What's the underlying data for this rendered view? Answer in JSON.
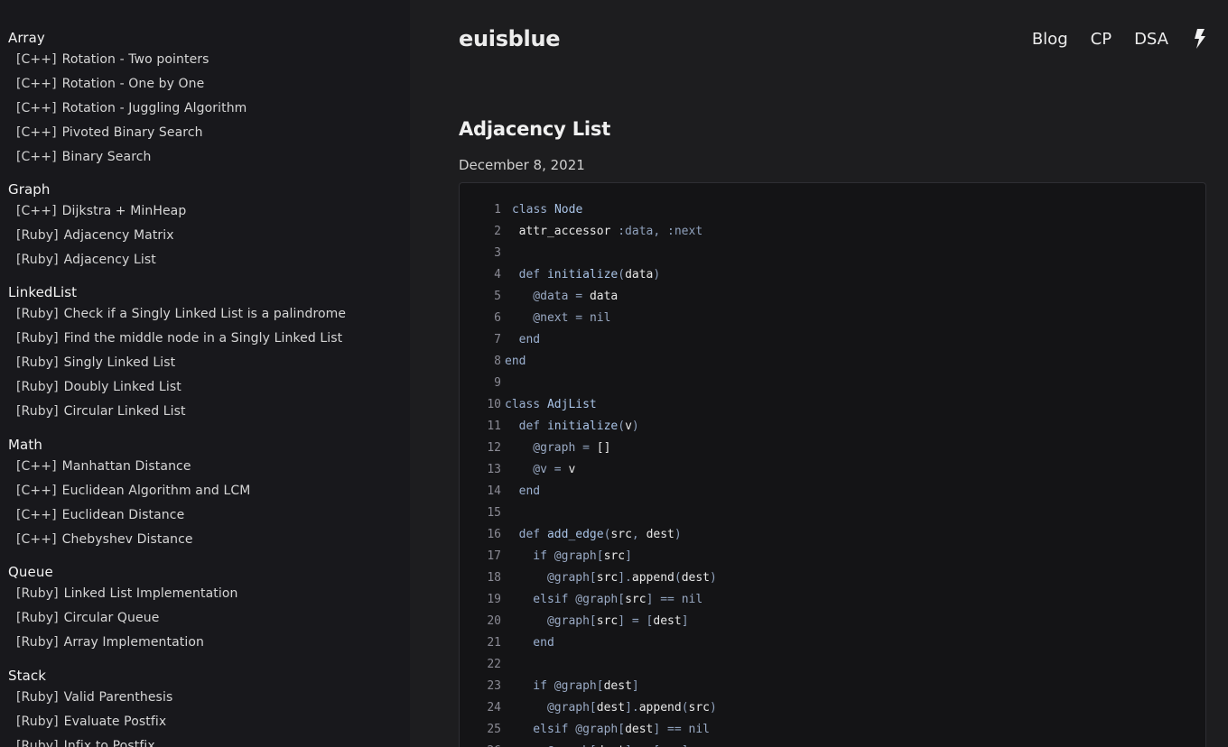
{
  "sidebar": {
    "groups": [
      {
        "title": "Array",
        "items": [
          {
            "lang": "[C++]",
            "label": "Rotation - Two pointers"
          },
          {
            "lang": "[C++]",
            "label": "Rotation - One by One"
          },
          {
            "lang": "[C++]",
            "label": "Rotation - Juggling Algorithm"
          },
          {
            "lang": "[C++]",
            "label": "Pivoted Binary Search"
          },
          {
            "lang": "[C++]",
            "label": "Binary Search"
          }
        ]
      },
      {
        "title": "Graph",
        "items": [
          {
            "lang": "[C++]",
            "label": "Dijkstra + MinHeap"
          },
          {
            "lang": "[Ruby]",
            "label": "Adjacency Matrix"
          },
          {
            "lang": "[Ruby]",
            "label": "Adjacency List"
          }
        ]
      },
      {
        "title": "LinkedList",
        "items": [
          {
            "lang": "[Ruby]",
            "label": "Check if a Singly Linked List is a palindrome"
          },
          {
            "lang": "[Ruby]",
            "label": "Find the middle node in a Singly Linked List"
          },
          {
            "lang": "[Ruby]",
            "label": "Singly Linked List"
          },
          {
            "lang": "[Ruby]",
            "label": "Doubly Linked List"
          },
          {
            "lang": "[Ruby]",
            "label": "Circular Linked List"
          }
        ]
      },
      {
        "title": "Math",
        "items": [
          {
            "lang": "[C++]",
            "label": "Manhattan Distance"
          },
          {
            "lang": "[C++]",
            "label": "Euclidean Algorithm and LCM"
          },
          {
            "lang": "[C++]",
            "label": "Euclidean Distance"
          },
          {
            "lang": "[C++]",
            "label": "Chebyshev Distance"
          }
        ]
      },
      {
        "title": "Queue",
        "items": [
          {
            "lang": "[Ruby]",
            "label": "Linked List Implementation"
          },
          {
            "lang": "[Ruby]",
            "label": "Circular Queue"
          },
          {
            "lang": "[Ruby]",
            "label": "Array Implementation"
          }
        ]
      },
      {
        "title": "Stack",
        "items": [
          {
            "lang": "[Ruby]",
            "label": "Valid Parenthesis"
          },
          {
            "lang": "[Ruby]",
            "label": "Evaluate Postfix"
          },
          {
            "lang": "[Ruby]",
            "label": "Infix to Postfix"
          }
        ]
      }
    ]
  },
  "header": {
    "brand": "euisblue",
    "nav": [
      "Blog",
      "CP",
      "DSA"
    ],
    "theme_icon": "bolt-icon"
  },
  "post": {
    "title": "Adjacency List",
    "date": "December 8, 2021"
  },
  "code": [
    [
      [
        "k",
        "class "
      ],
      [
        "c",
        "Node"
      ]
    ],
    [
      [
        "i",
        "  attr_accessor "
      ],
      [
        "s",
        ":data, :next"
      ]
    ],
    [],
    [
      [
        "k",
        "  def "
      ],
      [
        "c",
        "initialize"
      ],
      [
        "s",
        "("
      ],
      [
        "i",
        "data"
      ],
      [
        "s",
        ")"
      ]
    ],
    [
      [
        "v",
        "    @data"
      ],
      [
        "s",
        " = "
      ],
      [
        "i",
        "data"
      ]
    ],
    [
      [
        "v",
        "    @next"
      ],
      [
        "s",
        " = "
      ],
      [
        "n",
        "nil"
      ]
    ],
    [
      [
        "k",
        "  end"
      ]
    ],
    [
      [
        "k",
        "end"
      ]
    ],
    [],
    [
      [
        "k",
        "class "
      ],
      [
        "c",
        "AdjList"
      ]
    ],
    [
      [
        "k",
        "  def "
      ],
      [
        "c",
        "initialize"
      ],
      [
        "s",
        "("
      ],
      [
        "i",
        "v"
      ],
      [
        "s",
        ")"
      ]
    ],
    [
      [
        "v",
        "    @graph"
      ],
      [
        "s",
        " = "
      ],
      [
        "i",
        "[]"
      ]
    ],
    [
      [
        "v",
        "    @v"
      ],
      [
        "s",
        " = "
      ],
      [
        "i",
        "v"
      ]
    ],
    [
      [
        "k",
        "  end"
      ]
    ],
    [],
    [
      [
        "k",
        "  def "
      ],
      [
        "c",
        "add_edge"
      ],
      [
        "s",
        "("
      ],
      [
        "i",
        "src"
      ],
      [
        "s",
        ", "
      ],
      [
        "i",
        "dest"
      ],
      [
        "s",
        ")"
      ]
    ],
    [
      [
        "k",
        "    if "
      ],
      [
        "v",
        "@graph"
      ],
      [
        "s",
        "["
      ],
      [
        "i",
        "src"
      ],
      [
        "s",
        "]"
      ]
    ],
    [
      [
        "v",
        "      @graph"
      ],
      [
        "s",
        "["
      ],
      [
        "i",
        "src"
      ],
      [
        "s",
        "]."
      ],
      [
        "i",
        "append"
      ],
      [
        "s",
        "("
      ],
      [
        "i",
        "dest"
      ],
      [
        "s",
        ")"
      ]
    ],
    [
      [
        "k",
        "    elsif "
      ],
      [
        "v",
        "@graph"
      ],
      [
        "s",
        "["
      ],
      [
        "i",
        "src"
      ],
      [
        "s",
        "] == "
      ],
      [
        "n",
        "nil"
      ]
    ],
    [
      [
        "v",
        "      @graph"
      ],
      [
        "s",
        "["
      ],
      [
        "i",
        "src"
      ],
      [
        "s",
        "] = ["
      ],
      [
        "i",
        "dest"
      ],
      [
        "s",
        "]"
      ]
    ],
    [
      [
        "k",
        "    end"
      ]
    ],
    [],
    [
      [
        "k",
        "    if "
      ],
      [
        "v",
        "@graph"
      ],
      [
        "s",
        "["
      ],
      [
        "i",
        "dest"
      ],
      [
        "s",
        "]"
      ]
    ],
    [
      [
        "v",
        "      @graph"
      ],
      [
        "s",
        "["
      ],
      [
        "i",
        "dest"
      ],
      [
        "s",
        "]."
      ],
      [
        "i",
        "append"
      ],
      [
        "s",
        "("
      ],
      [
        "i",
        "src"
      ],
      [
        "s",
        ")"
      ]
    ],
    [
      [
        "k",
        "    elsif "
      ],
      [
        "v",
        "@graph"
      ],
      [
        "s",
        "["
      ],
      [
        "i",
        "dest"
      ],
      [
        "s",
        "] == "
      ],
      [
        "n",
        "nil"
      ]
    ],
    [
      [
        "v",
        "      @graph"
      ],
      [
        "s",
        "["
      ],
      [
        "i",
        "dest"
      ],
      [
        "s",
        "] = ["
      ],
      [
        "i",
        "src"
      ],
      [
        "s",
        "]"
      ]
    ]
  ]
}
